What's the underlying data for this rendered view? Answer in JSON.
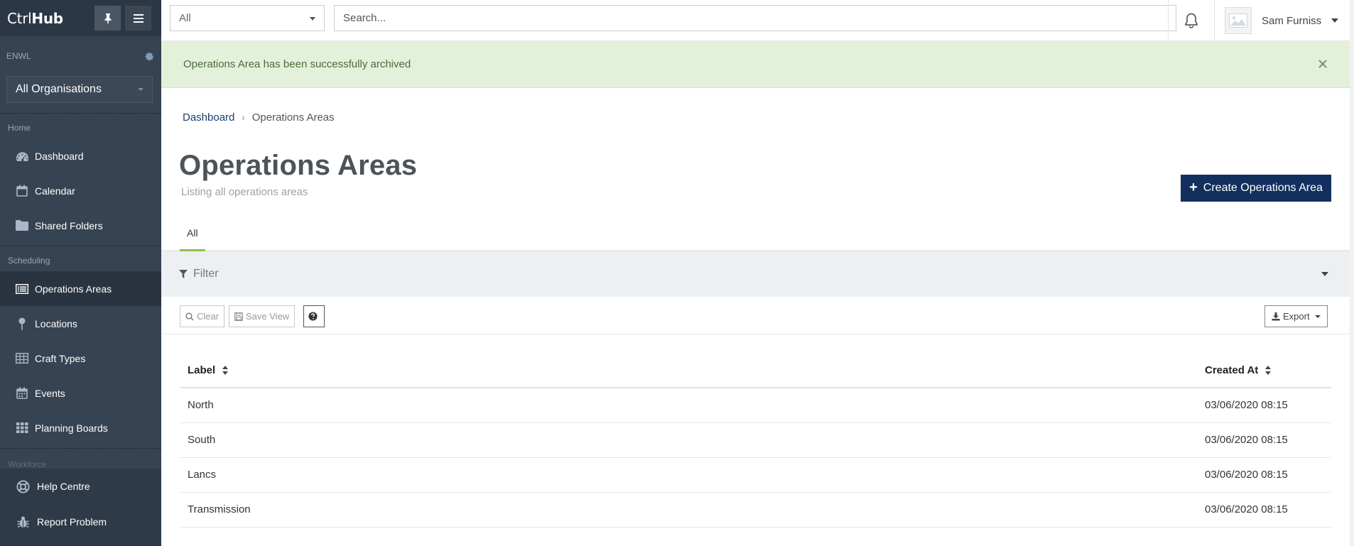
{
  "app": {
    "brand_prefix": "Ctrl",
    "brand_suffix": "Hub"
  },
  "sidebar": {
    "org_code": "ENWL",
    "org_select": "All Organisations",
    "sections": {
      "home": "Home",
      "scheduling": "Scheduling",
      "workforce": "Workforce"
    },
    "home_items": [
      {
        "label": "Dashboard",
        "icon": "dashboard-icon"
      },
      {
        "label": "Calendar",
        "icon": "calendar-icon"
      },
      {
        "label": "Shared Folders",
        "icon": "folder-icon"
      }
    ],
    "scheduling_items": [
      {
        "label": "Operations Areas",
        "icon": "list-icon",
        "active": true
      },
      {
        "label": "Locations",
        "icon": "map-pin-icon"
      },
      {
        "label": "Craft Types",
        "icon": "table-icon"
      },
      {
        "label": "Events",
        "icon": "calendar-icon"
      },
      {
        "label": "Planning Boards",
        "icon": "grid-icon"
      }
    ],
    "footer_items": [
      {
        "label": "Help Centre",
        "icon": "life-ring-icon"
      },
      {
        "label": "Report Problem",
        "icon": "bug-icon"
      }
    ]
  },
  "topbar": {
    "scope_value": "All",
    "search_placeholder": "Search...",
    "user_name": "Sam Furniss"
  },
  "alert": {
    "message": "Operations Area has been successfully archived"
  },
  "breadcrumb": {
    "root": "Dashboard",
    "current": "Operations Areas"
  },
  "page": {
    "title": "Operations Areas",
    "subtitle": "Listing all operations areas",
    "create_label": "Create Operations Area",
    "tab_all": "All",
    "filter_label": "Filter"
  },
  "toolbar": {
    "clear_label": "Clear",
    "save_view_label": "Save View",
    "export_label": "Export"
  },
  "table": {
    "columns": [
      "Label",
      "Created At"
    ],
    "rows": [
      {
        "label": "North",
        "created_at": "03/06/2020 08:15"
      },
      {
        "label": "South",
        "created_at": "03/06/2020 08:15"
      },
      {
        "label": "Lancs",
        "created_at": "03/06/2020 08:15"
      },
      {
        "label": "Transmission",
        "created_at": "03/06/2020 08:15"
      }
    ]
  },
  "colors": {
    "sidebar_bg": "#364352",
    "primary": "#12305e",
    "success_bg": "#e3f1da",
    "tab_accent": "#8bc34a"
  }
}
